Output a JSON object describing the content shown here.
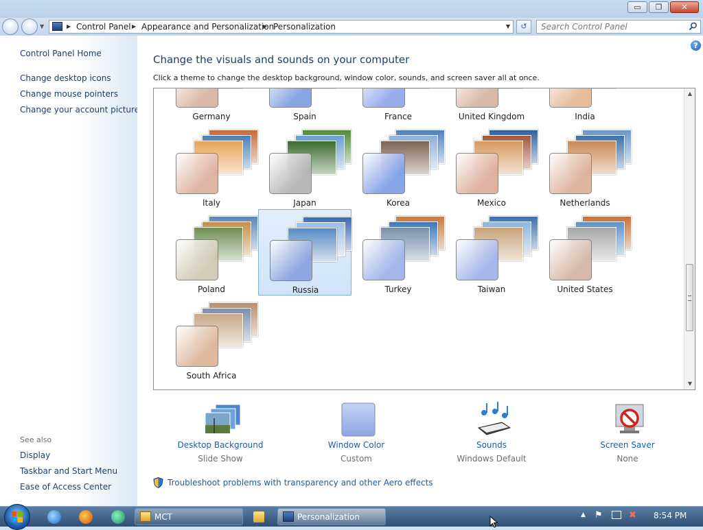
{
  "window": {
    "caption_buttons": {
      "minimize": "▭",
      "maximize": "❐",
      "close": "✕"
    }
  },
  "address": {
    "crumbs": [
      "Control Panel",
      "Appearance and Personalization",
      "Personalization"
    ],
    "search_placeholder": "Search Control Panel"
  },
  "sidebar": {
    "home": "Control Panel Home",
    "tasks": [
      "Change desktop icons",
      "Change mouse pointers",
      "Change your account picture"
    ],
    "see_also_label": "See also",
    "see_also": [
      "Display",
      "Taskbar and Start Menu",
      "Ease of Access Center"
    ]
  },
  "main": {
    "title": "Change the visuals and sounds on your computer",
    "subtitle": "Click a theme to change the desktop background, window color, sounds, and screen saver all at once.",
    "themes": [
      {
        "label": "Germany",
        "swatch": "#d9b49f",
        "colors": [
          "#7a5a3c",
          "#b49877",
          "#5d7fa0"
        ]
      },
      {
        "label": "Spain",
        "swatch": "#7f9fe0",
        "colors": [
          "#a9b8d0",
          "#c5a57d",
          "#6d8fb8"
        ]
      },
      {
        "label": "France",
        "swatch": "#8fa8ea",
        "colors": [
          "#b8c6e0",
          "#8b6f55",
          "#d0b28a"
        ]
      },
      {
        "label": "United Kingdom",
        "swatch": "#d8b4a2",
        "colors": [
          "#8a6b55",
          "#a58e78",
          "#6f8fa8"
        ]
      },
      {
        "label": "India",
        "swatch": "#e6b894",
        "colors": [
          "#c0a27c",
          "#9b7b5c",
          "#d7c3a6"
        ]
      },
      {
        "label": "Italy",
        "swatch": "#dcae9c",
        "colors": [
          "#c76a3c",
          "#4a7fb6",
          "#e8a35a"
        ]
      },
      {
        "label": "Japan",
        "swatch": "#b3b3b3",
        "colors": [
          "#4f8a3a",
          "#6a9ecf",
          "#3c6b2f"
        ]
      },
      {
        "label": "Korea",
        "swatch": "#7d9ee8",
        "colors": [
          "#4f7fbf",
          "#8fb0d8",
          "#7a6350"
        ]
      },
      {
        "label": "Mexico",
        "swatch": "#dcab98",
        "colors": [
          "#2f5fa6",
          "#a4573a",
          "#d79a62"
        ]
      },
      {
        "label": "Netherlands",
        "swatch": "#dcae95",
        "colors": [
          "#6d95c7",
          "#3f6fa8",
          "#c98a55"
        ]
      },
      {
        "label": "Poland",
        "swatch": "#cfc8b4",
        "colors": [
          "#5d86b6",
          "#c98c4c",
          "#6f8f55"
        ]
      },
      {
        "label": "Russia",
        "swatch": "#8aa2de",
        "colors": [
          "#3a69b2",
          "#9cc0e8",
          "#5a8cc4"
        ]
      },
      {
        "label": "Turkey",
        "swatch": "#9db1e8",
        "colors": [
          "#c87a3f",
          "#3e78b8",
          "#7a8fa8"
        ]
      },
      {
        "label": "Taiwan",
        "swatch": "#9fb3ea",
        "colors": [
          "#3d6fae",
          "#8db7dc",
          "#c7a27a"
        ]
      },
      {
        "label": "United States",
        "swatch": "#d5b5a4",
        "colors": [
          "#c5723a",
          "#5f91c8",
          "#a8a8a8"
        ]
      },
      {
        "label": "South Africa",
        "swatch": "#ddb396",
        "colors": [
          "#b88f6e",
          "#7f8fa8",
          "#c9a98a"
        ]
      }
    ],
    "selected_theme": "Russia"
  },
  "options": [
    {
      "name": "Desktop Background",
      "value": "Slide Show"
    },
    {
      "name": "Window Color",
      "value": "Custom"
    },
    {
      "name": "Sounds",
      "value": "Windows Default"
    },
    {
      "name": "Screen Saver",
      "value": "None"
    }
  ],
  "troubleshoot_link": "Troubleshoot problems with transparency and other Aero effects",
  "taskbar": {
    "buttons": [
      {
        "label": "MCT"
      },
      {
        "label": "Personalization"
      }
    ],
    "clock": "8:54 PM"
  },
  "colors": {
    "link": "#1e5ca8",
    "heading": "#1e3f6b",
    "selection_bg": "#cfe3fa",
    "taskbar": "#2f4f74"
  }
}
